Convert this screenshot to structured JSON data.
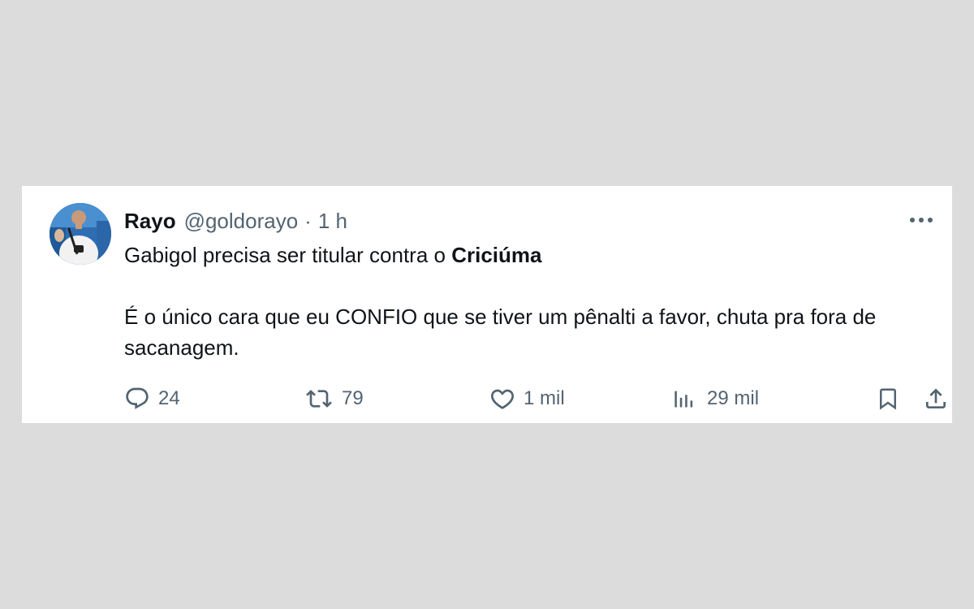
{
  "tweet": {
    "display_name": "Rayo",
    "handle": "@goldorayo",
    "separator": "·",
    "time": "1 h",
    "text_line1_prefix": "Gabigol precisa ser titular contra o ",
    "text_line1_bold": "Criciúma",
    "text_paragraph2": "É o único cara que eu CONFIO que se tiver um pênalti a favor, chuta pra fora de sacanagem."
  },
  "actions": {
    "reply_count": "24",
    "retweet_count": "79",
    "like_count": "1 mil",
    "views_count": "29 mil"
  },
  "icons": {
    "reply": "reply-icon",
    "retweet": "retweet-icon",
    "like": "heart-icon",
    "views": "views-icon",
    "bookmark": "bookmark-icon",
    "share": "share-icon",
    "more": "more-icon"
  },
  "colors": {
    "background": "#dcdcdc",
    "card": "#ffffff",
    "text": "#0f1419",
    "secondary": "#536471"
  }
}
